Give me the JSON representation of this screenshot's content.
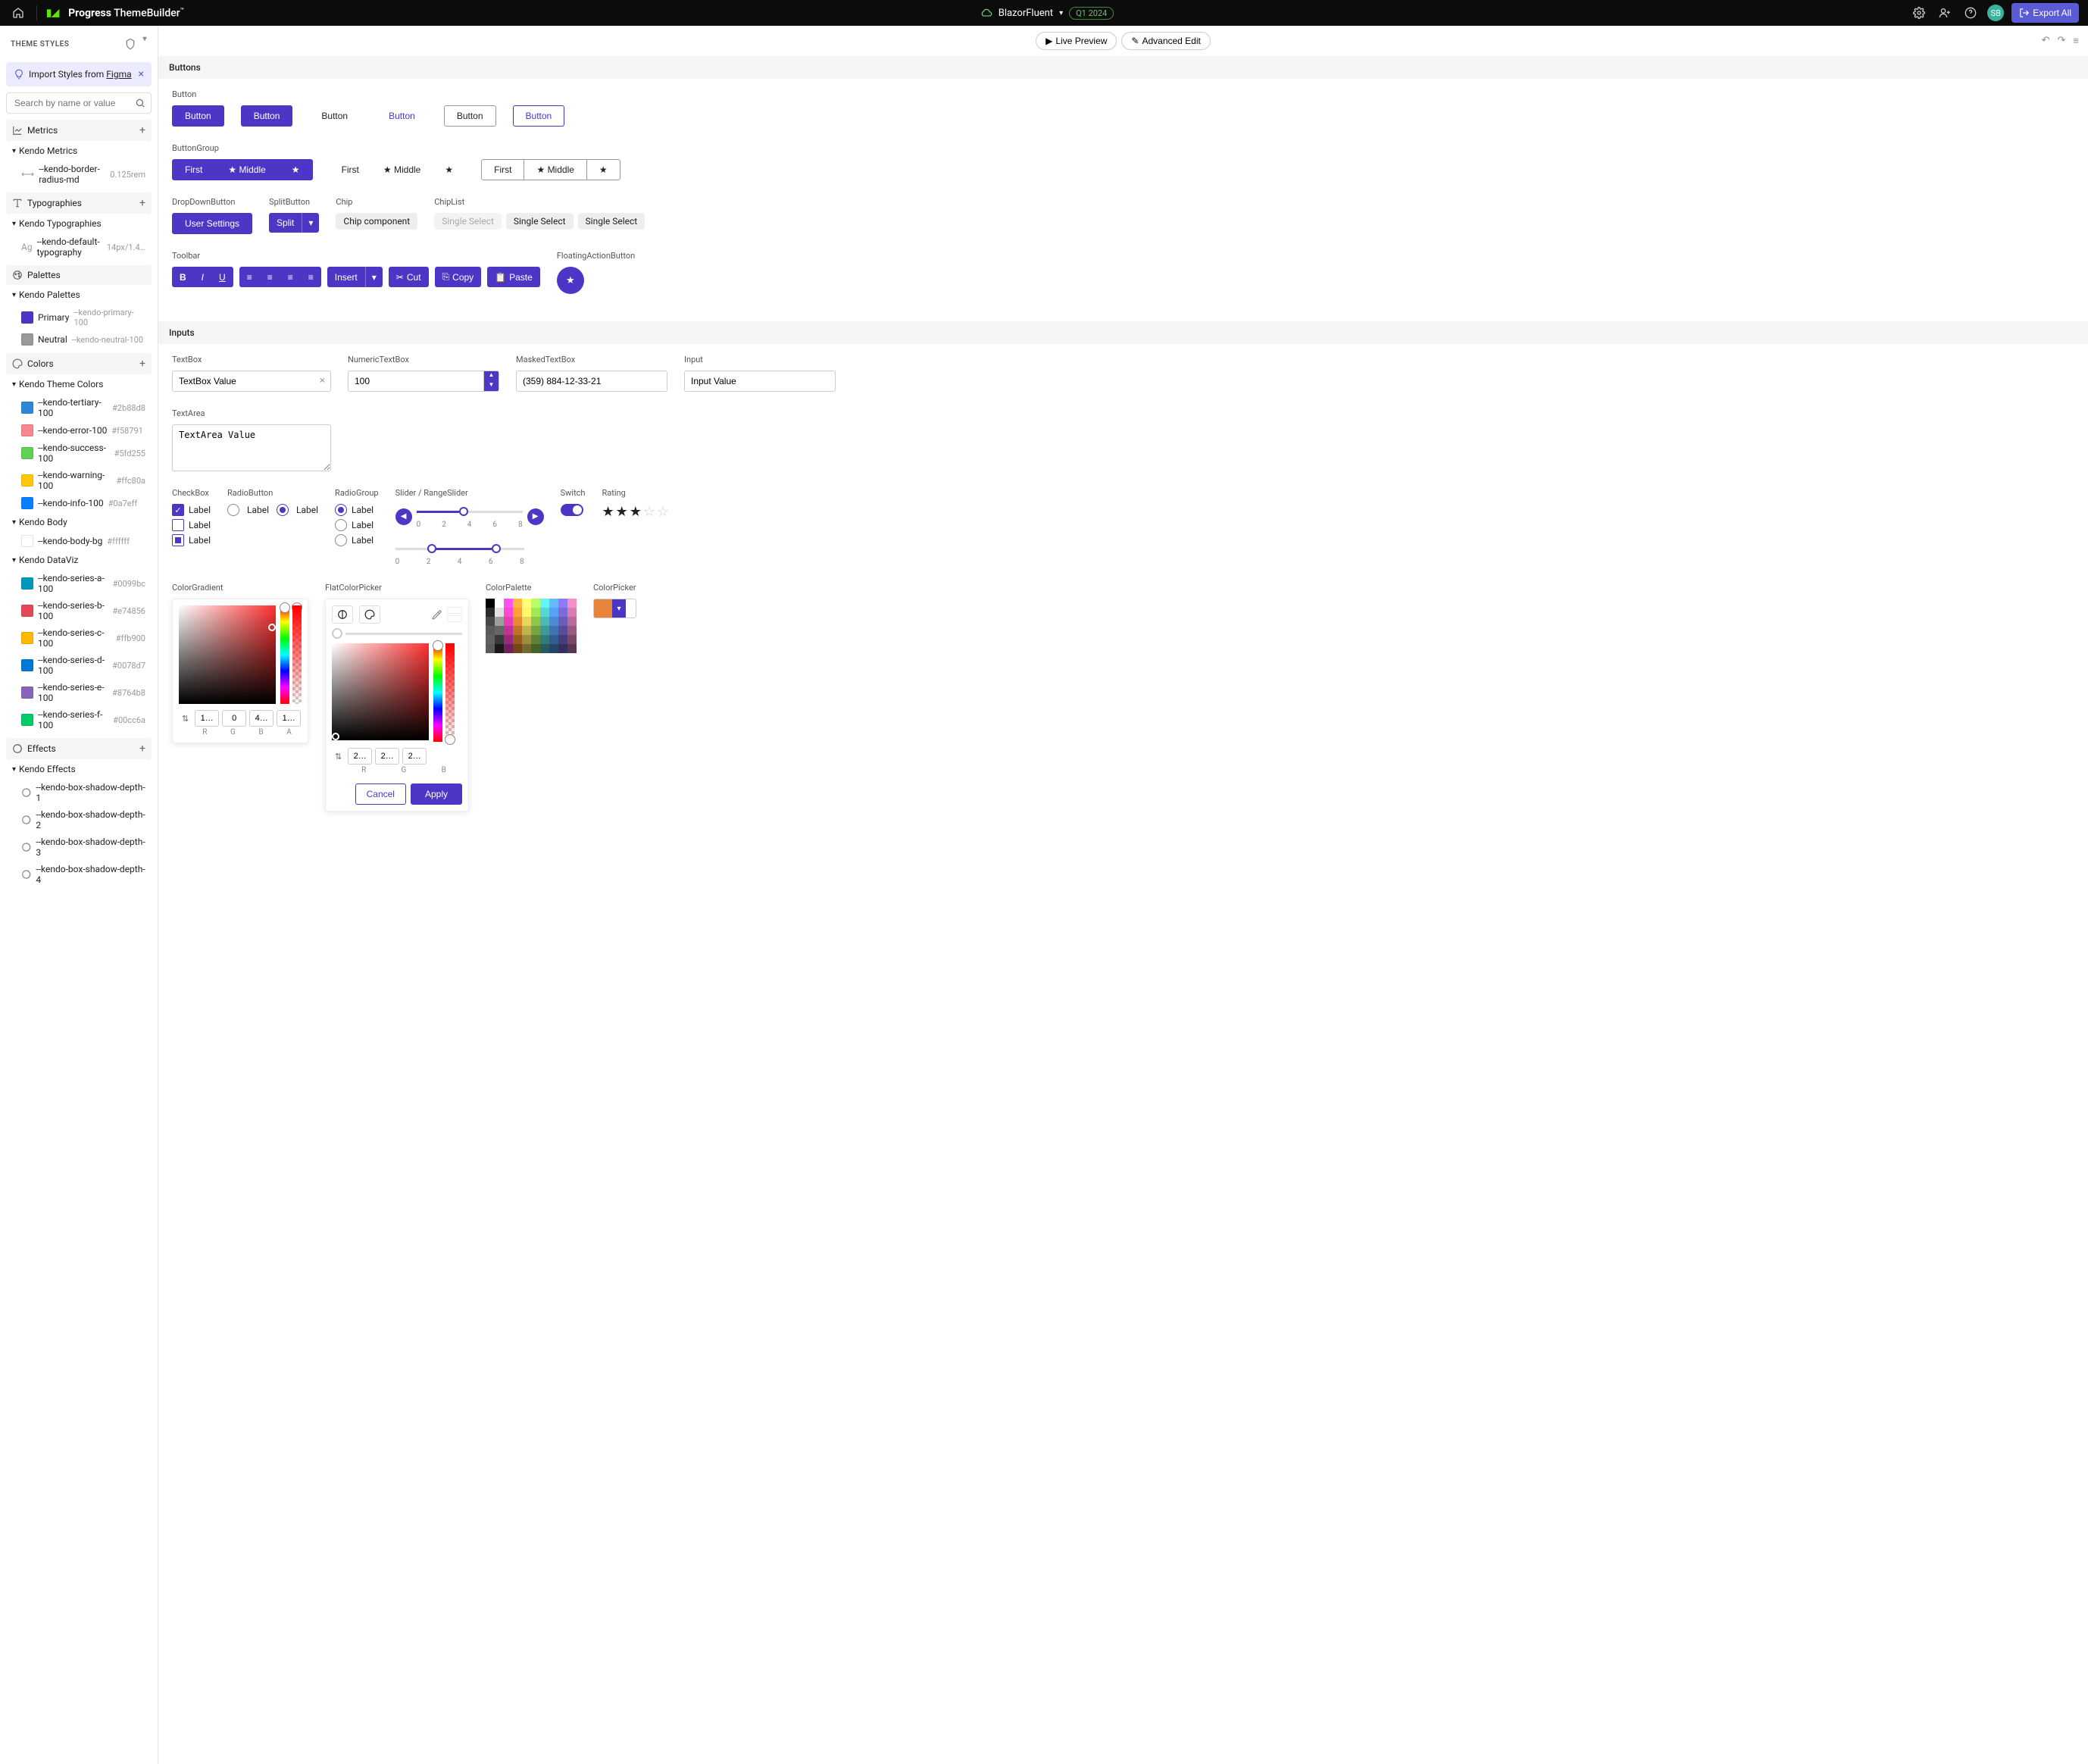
{
  "topbar": {
    "brand_a": "Progress",
    "brand_b": "ThemeBuilder",
    "project": "BlazorFluent",
    "version": "Q1 2024",
    "avatar": "SB",
    "export": "Export All"
  },
  "sidebar": {
    "title": "THEME STYLES",
    "figma": "Import Styles from ",
    "figma_link": "Figma",
    "search_placeholder": "Search by name or value",
    "sections": {
      "metrics": "Metrics",
      "metrics_group": "Kendo Metrics",
      "metric_item": "--kendo-border-radius-md",
      "metric_val": "0.125rem",
      "typo": "Typographies",
      "typo_group": "Kendo Typographies",
      "typo_item": "--kendo-default-typography",
      "typo_val": "14px/1.4…",
      "palettes": "Palettes",
      "palettes_group": "Kendo Palettes",
      "pal_primary": "Primary",
      "pal_primary_sub": "--kendo-primary-100",
      "pal_neutral": "Neutral",
      "pal_neutral_sub": "--kendo-neutral-100",
      "colors": "Colors",
      "theme_colors": "Kendo Theme Colors",
      "color_items": [
        {
          "name": "--kendo-tertiary-100",
          "val": "#2b88d8",
          "c": "#2b88d8"
        },
        {
          "name": "--kendo-error-100",
          "val": "#f58791",
          "c": "#f58791"
        },
        {
          "name": "--kendo-success-100",
          "val": "#5fd255",
          "c": "#5fd255"
        },
        {
          "name": "--kendo-warning-100",
          "val": "#ffc80a",
          "c": "#ffc80a"
        },
        {
          "name": "--kendo-info-100",
          "val": "#0a7eff",
          "c": "#0a7eff"
        }
      ],
      "body": "Kendo Body",
      "body_item": "--kendo-body-bg",
      "body_val": "#ffffff",
      "dataviz": "Kendo DataViz",
      "dataviz_items": [
        {
          "name": "--kendo-series-a-100",
          "val": "#0099bc",
          "c": "#0099bc"
        },
        {
          "name": "--kendo-series-b-100",
          "val": "#e74856",
          "c": "#e74856"
        },
        {
          "name": "--kendo-series-c-100",
          "val": "#ffb900",
          "c": "#ffb900"
        },
        {
          "name": "--kendo-series-d-100",
          "val": "#0078d7",
          "c": "#0078d7"
        },
        {
          "name": "--kendo-series-e-100",
          "val": "#8764b8",
          "c": "#8764b8"
        },
        {
          "name": "--kendo-series-f-100",
          "val": "#00cc6a",
          "c": "#00cc6a"
        }
      ],
      "effects": "Effects",
      "effects_group": "Kendo Effects",
      "effect_items": [
        "--kendo-box-shadow-depth-1",
        "--kendo-box-shadow-depth-2",
        "--kendo-box-shadow-depth-3",
        "--kendo-box-shadow-depth-4"
      ]
    }
  },
  "preview": {
    "live": "Live Preview",
    "advanced": "Advanced Edit"
  },
  "buttons_section": {
    "title": "Buttons",
    "button_label": "Button",
    "btn_text": "Button",
    "btngroup_label": "ButtonGroup",
    "first": "First",
    "middle": "Middle",
    "dropdown_label": "DropDownButton",
    "dropdown_text": "User Settings",
    "split_label": "SplitButton",
    "split_text": "Split",
    "chip_label": "Chip",
    "chip_text": "Chip component",
    "chiplist_label": "ChipList",
    "chiplist_text": "Single Select",
    "toolbar_label": "Toolbar",
    "insert": "Insert",
    "cut": "Cut",
    "copy": "Copy",
    "paste": "Paste",
    "fab_label": "FloatingActionButton"
  },
  "inputs_section": {
    "title": "Inputs",
    "textbox_label": "TextBox",
    "textbox_val": "TextBox Value",
    "numeric_label": "NumericTextBox",
    "numeric_val": "100",
    "masked_label": "MaskedTextBox",
    "masked_val": "(359) 884-12-33-21",
    "input_label": "Input",
    "input_val": "Input Value",
    "textarea_label": "TextArea",
    "textarea_val": "TextArea Value",
    "checkbox_label": "CheckBox",
    "radio_label": "RadioButton",
    "radiogroup_label": "RadioGroup",
    "label": "Label",
    "slider_label": "Slider / RangeSlider",
    "ticks": [
      "0",
      "2",
      "4",
      "6",
      "8"
    ],
    "switch_label": "Switch",
    "rating_label": "Rating",
    "colorgradient_label": "ColorGradient",
    "rgba": {
      "r": "1…",
      "g": "0",
      "b": "4…",
      "a": "1…",
      "R": "R",
      "G": "G",
      "B": "B",
      "A": "A"
    },
    "flat_label": "FlatColorPicker",
    "flat_rgb": {
      "r": "2…",
      "g": "2…",
      "b": "2…",
      "R": "R",
      "G": "G",
      "B": "B"
    },
    "cancel": "Cancel",
    "apply": "Apply",
    "palette_label": "ColorPalette",
    "colorpicker_label": "ColorPicker"
  }
}
